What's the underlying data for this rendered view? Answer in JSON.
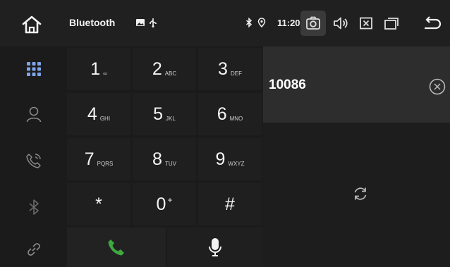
{
  "statusbar": {
    "title": "Bluetooth",
    "time": "11:20",
    "icons": [
      "home-icon",
      "image-icon",
      "usb-icon",
      "bluetooth-icon",
      "location-icon",
      "camera-icon",
      "volume-icon",
      "close-box-icon",
      "recent-apps-icon",
      "back-icon"
    ]
  },
  "sidebar": {
    "items": [
      {
        "name": "dialpad",
        "active": true
      },
      {
        "name": "contacts",
        "active": false
      },
      {
        "name": "call-log",
        "active": false
      },
      {
        "name": "bluetooth",
        "active": false
      },
      {
        "name": "link",
        "active": false
      }
    ]
  },
  "keypad": {
    "keys": [
      {
        "digit": "1",
        "sub": "∞"
      },
      {
        "digit": "2",
        "sub": "ABC"
      },
      {
        "digit": "3",
        "sub": "DEF"
      },
      {
        "digit": "4",
        "sub": "GHI"
      },
      {
        "digit": "5",
        "sub": "JKL"
      },
      {
        "digit": "6",
        "sub": "MNO"
      },
      {
        "digit": "7",
        "sub": "PQRS"
      },
      {
        "digit": "8",
        "sub": "TUV"
      },
      {
        "digit": "9",
        "sub": "WXYZ"
      },
      {
        "digit": "*",
        "sub": ""
      },
      {
        "digit": "0",
        "sup": "+"
      },
      {
        "digit": "#",
        "sub": ""
      }
    ]
  },
  "dial": {
    "number": "10086"
  },
  "colors": {
    "accent_active": "#7fa5e8",
    "call_green": "#3fa93f",
    "icon_dim": "#8a8a8a"
  }
}
